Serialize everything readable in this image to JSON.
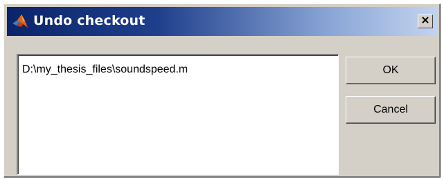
{
  "window": {
    "title": "Undo checkout",
    "title_icon": "matlab-logo-icon",
    "close_icon": "close-icon"
  },
  "file_list": {
    "items": [
      "D:\\my_thesis_files\\soundspeed.m"
    ]
  },
  "buttons": {
    "ok_label": "OK",
    "cancel_label": "Cancel"
  },
  "colors": {
    "dialog_face": "#d4d0c8",
    "titlebar_start": "#0a246a",
    "titlebar_end": "#c3d3ee",
    "title_text": "#ffffff"
  }
}
